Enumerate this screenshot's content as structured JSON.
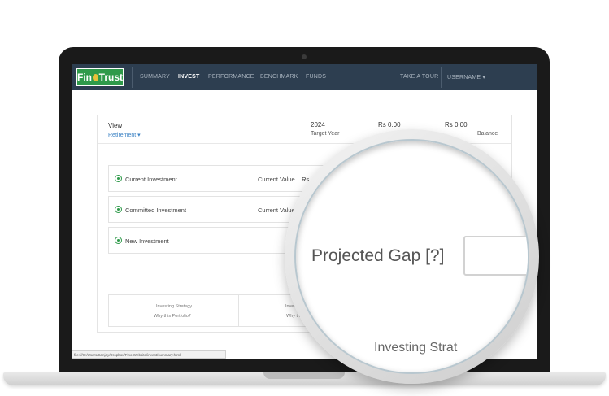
{
  "navbar": {
    "logo": {
      "left": "Fin",
      "right": "Trust"
    },
    "items": [
      {
        "label": "SUMMARY",
        "active": false
      },
      {
        "label": "INVEST",
        "active": true
      },
      {
        "label": "PERFORMANCE",
        "active": false
      },
      {
        "label": "BENCHMARK",
        "active": false
      },
      {
        "label": "FUNDS",
        "active": false
      }
    ],
    "take_tour": "TAKE A TOUR",
    "username": "USERNAME ▾"
  },
  "view": {
    "label": "View",
    "selected": "Retirement ▾"
  },
  "stats": [
    {
      "value": "2024",
      "label": "Target Year"
    },
    {
      "value": "Rs 0.00",
      "label": ""
    },
    {
      "value": "Rs 0.00",
      "label": "Balance"
    }
  ],
  "rows": [
    {
      "label": "Current Investment",
      "value_label": "Current Value",
      "value": "Rs"
    },
    {
      "label": "Committed Investment",
      "value_label": "Current Value",
      "value": ""
    },
    {
      "label": "New Investment",
      "value_label": "",
      "value": ""
    }
  ],
  "strategy": {
    "left": {
      "title": "Investing Strategy",
      "subtitle": "Why this Portfolio?"
    },
    "right": {
      "title": "Invest",
      "subtitle": "Why th"
    }
  },
  "statusbar": "file:///C:/Users/Sanjay/Dropbox/Fino Website/invest/summary.html",
  "magnifier": {
    "projected_gap": "Projected Gap [?]",
    "investing_strategy": "Investing Strat"
  },
  "colors": {
    "navbar": "#2d3e50",
    "brand_green": "#2f9a4a",
    "link_blue": "#3b82c4"
  }
}
